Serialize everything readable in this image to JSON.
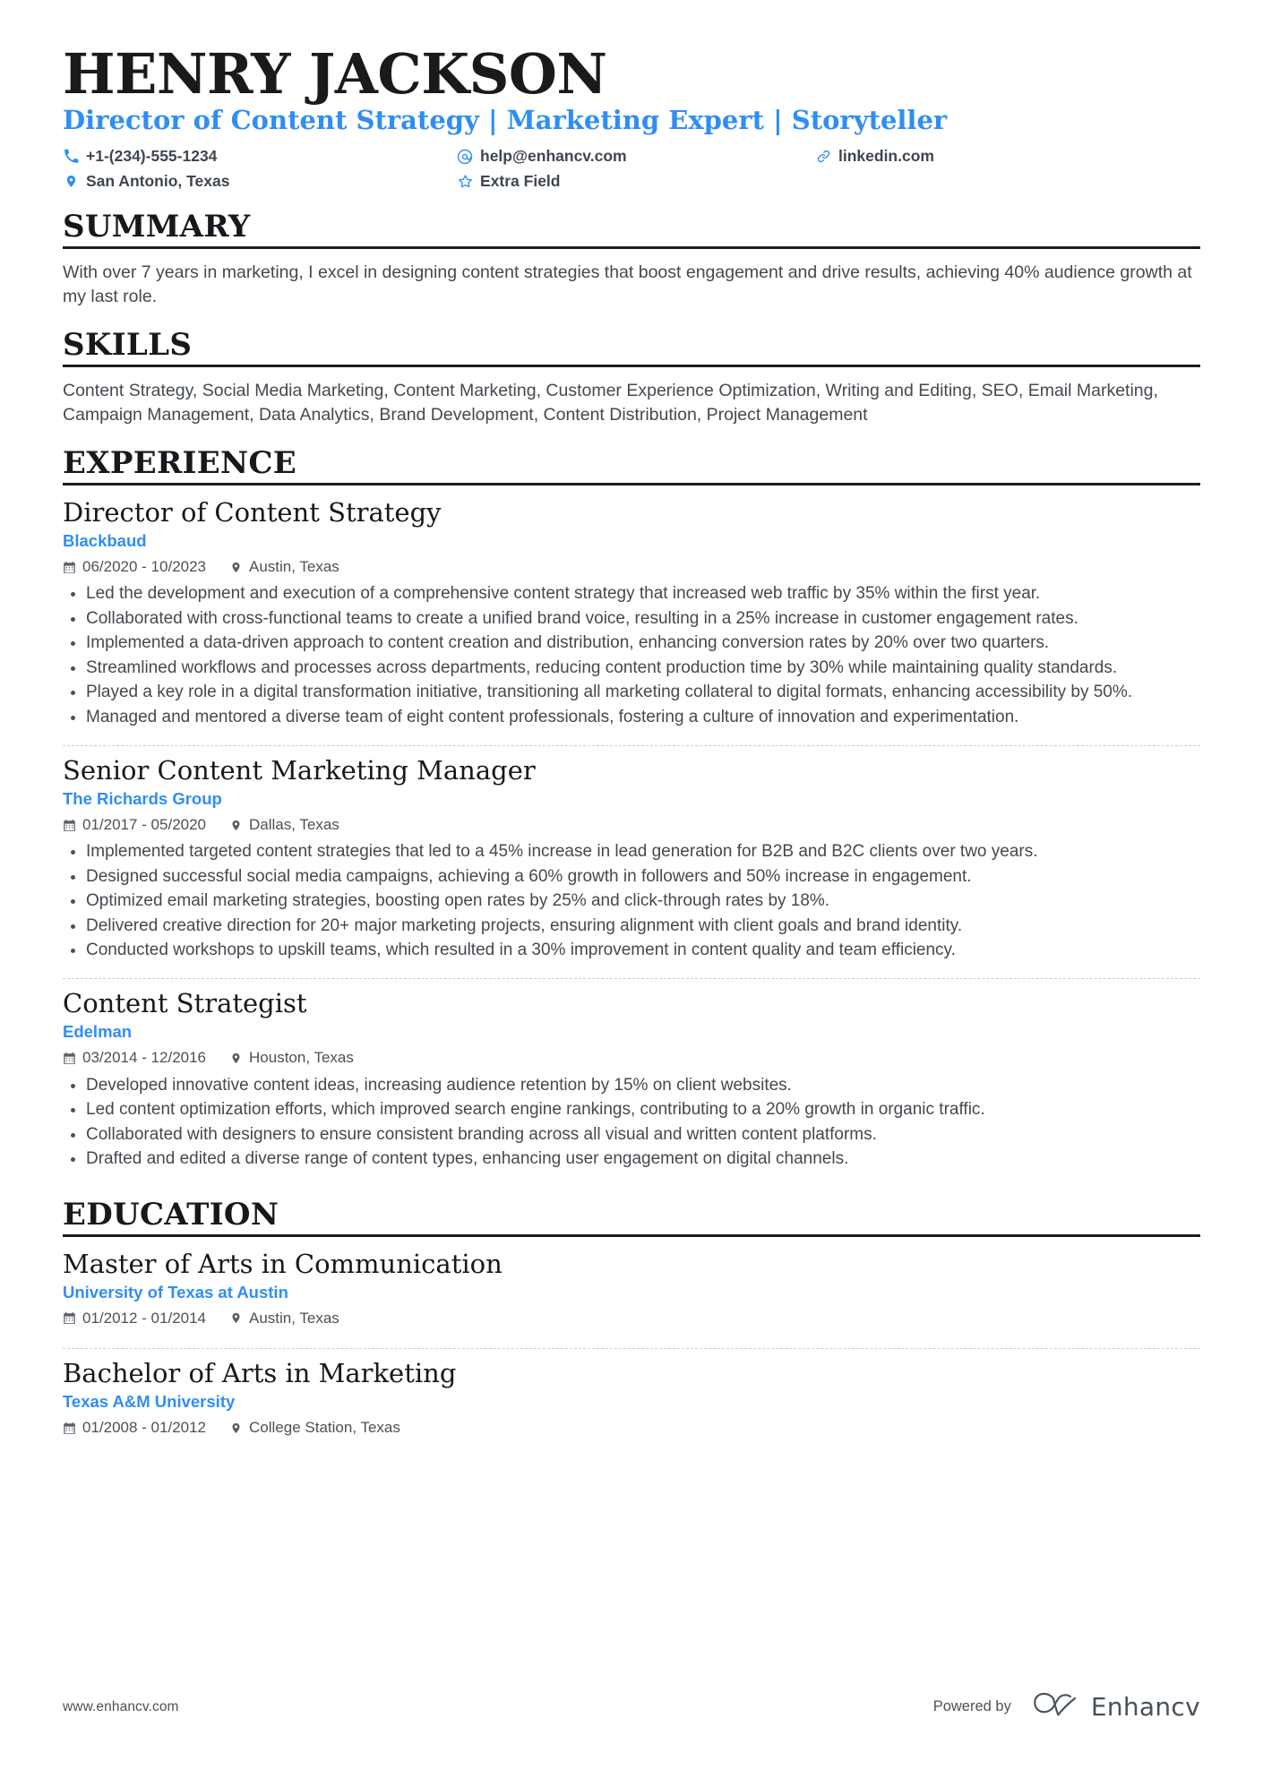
{
  "colors": {
    "accent": "#2f8ef4",
    "text": "#43494f",
    "heading": "#16181c",
    "rule": "#1a1d21"
  },
  "header": {
    "name": "HENRY JACKSON",
    "headline": "Director of Content Strategy | Marketing Expert | Storyteller",
    "contacts": [
      {
        "icon": "phone-icon",
        "text": "+1-(234)-555-1234"
      },
      {
        "icon": "email-icon",
        "text": "help@enhancv.com"
      },
      {
        "icon": "link-icon",
        "text": "linkedin.com"
      },
      {
        "icon": "location-icon",
        "text": "San Antonio, Texas"
      },
      {
        "icon": "star-icon",
        "text": "Extra Field"
      }
    ]
  },
  "sections": {
    "summary": {
      "title": "SUMMARY",
      "text": "With over 7 years in marketing, I excel in designing content strategies that boost engagement and drive results, achieving 40% audience growth at my last role."
    },
    "skills": {
      "title": "SKILLS",
      "text": "Content Strategy, Social Media Marketing, Content Marketing, Customer Experience Optimization, Writing and Editing, SEO, Email Marketing, Campaign Management, Data Analytics, Brand Development, Content Distribution, Project Management"
    },
    "experience": {
      "title": "EXPERIENCE",
      "entries": [
        {
          "title": "Director of Content Strategy",
          "org": "Blackbaud",
          "dates": "06/2020 - 10/2023",
          "location": "Austin, Texas",
          "bullets": [
            "Led the development and execution of a comprehensive content strategy that increased web traffic by 35% within the first year.",
            "Collaborated with cross-functional teams to create a unified brand voice, resulting in a 25% increase in customer engagement rates.",
            "Implemented a data-driven approach to content creation and distribution, enhancing conversion rates by 20% over two quarters.",
            "Streamlined workflows and processes across departments, reducing content production time by 30% while maintaining quality standards.",
            "Played a key role in a digital transformation initiative, transitioning all marketing collateral to digital formats, enhancing accessibility by 50%.",
            "Managed and mentored a diverse team of eight content professionals, fostering a culture of innovation and experimentation."
          ]
        },
        {
          "title": "Senior Content Marketing Manager",
          "org": "The Richards Group",
          "dates": "01/2017 - 05/2020",
          "location": "Dallas, Texas",
          "bullets": [
            "Implemented targeted content strategies that led to a 45% increase in lead generation for B2B and B2C clients over two years.",
            "Designed successful social media campaigns, achieving a 60% growth in followers and 50% increase in engagement.",
            "Optimized email marketing strategies, boosting open rates by 25% and click-through rates by 18%.",
            "Delivered creative direction for 20+ major marketing projects, ensuring alignment with client goals and brand identity.",
            "Conducted workshops to upskill teams, which resulted in a 30% improvement in content quality and team efficiency."
          ]
        },
        {
          "title": "Content Strategist",
          "org": "Edelman",
          "dates": "03/2014 - 12/2016",
          "location": "Houston, Texas",
          "bullets": [
            "Developed innovative content ideas, increasing audience retention by 15% on client websites.",
            "Led content optimization efforts, which improved search engine rankings, contributing to a 20% growth in organic traffic.",
            "Collaborated with designers to ensure consistent branding across all visual and written content platforms.",
            "Drafted and edited a diverse range of content types, enhancing user engagement on digital channels."
          ]
        }
      ]
    },
    "education": {
      "title": "EDUCATION",
      "entries": [
        {
          "title": "Master of Arts in Communication",
          "org": "University of Texas at Austin",
          "dates": "01/2012 - 01/2014",
          "location": "Austin, Texas"
        },
        {
          "title": "Bachelor of Arts in Marketing",
          "org": "Texas A&M University",
          "dates": "01/2008 - 01/2012",
          "location": "College Station, Texas"
        }
      ]
    }
  },
  "footer": {
    "url": "www.enhancv.com",
    "powered_by": "Powered by",
    "brand": "Enhancv"
  }
}
